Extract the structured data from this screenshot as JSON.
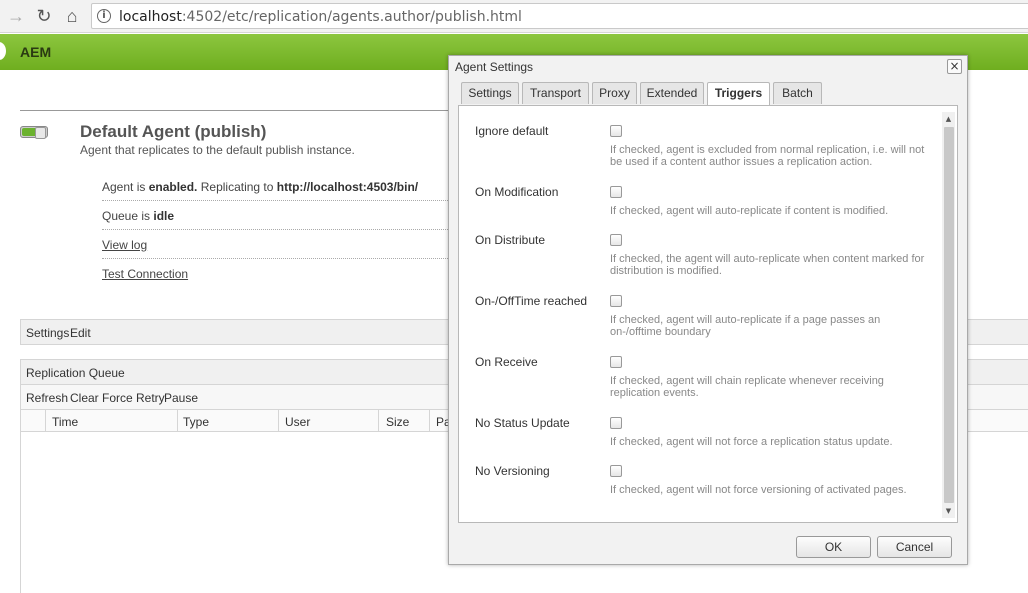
{
  "browser": {
    "url_host": "localhost",
    "url_rest": ":4502/etc/replication/agents.author/publish.html"
  },
  "header": {
    "title": "AEM"
  },
  "agent": {
    "title": "Default Agent (publish)",
    "description": "Agent that replicates to the default publish instance.",
    "status_prefix": "Agent is ",
    "status_value": "enabled.",
    "status_mid": " Replicating to ",
    "status_target": "http://localhost:4503/bin/",
    "queue_prefix": "Queue is ",
    "queue_value": "idle",
    "view_log": "View log",
    "test_connection": "Test Connection"
  },
  "settings_bar": {
    "label": "Settings",
    "edit": "Edit"
  },
  "queue": {
    "title": "Replication Queue",
    "actions": [
      "Refresh",
      "Clear",
      "Force Retry",
      "Pause"
    ],
    "columns": [
      "Time",
      "Type",
      "User",
      "Size",
      "Pa"
    ]
  },
  "dialog": {
    "title": "Agent Settings",
    "close_icon": "×",
    "tabs": [
      "Settings",
      "Transport",
      "Proxy",
      "Extended",
      "Triggers",
      "Batch"
    ],
    "active_tab": "Triggers",
    "triggers": [
      {
        "label": "Ignore default",
        "checked": false,
        "help": "If checked, agent is excluded from normal replication, i.e. will not be used if a content author issues a replication action."
      },
      {
        "label": "On Modification",
        "checked": false,
        "help": "If checked, agent will auto-replicate if content is modified."
      },
      {
        "label": "On Distribute",
        "checked": false,
        "help": "If checked, the agent will auto-replicate when content marked for distribution is modified."
      },
      {
        "label": "On-/OffTime reached",
        "checked": false,
        "help": "If checked, agent will auto-replicate if a page passes an on-/offtime boundary"
      },
      {
        "label": "On Receive",
        "checked": false,
        "help": "If checked, agent will chain replicate whenever receiving replication events."
      },
      {
        "label": "No Status Update",
        "checked": false,
        "help": "If checked, agent will not force a replication status update."
      },
      {
        "label": "No Versioning",
        "checked": false,
        "help": "If checked, agent will not force versioning of activated pages."
      }
    ],
    "ok_label": "OK",
    "cancel_label": "Cancel"
  }
}
